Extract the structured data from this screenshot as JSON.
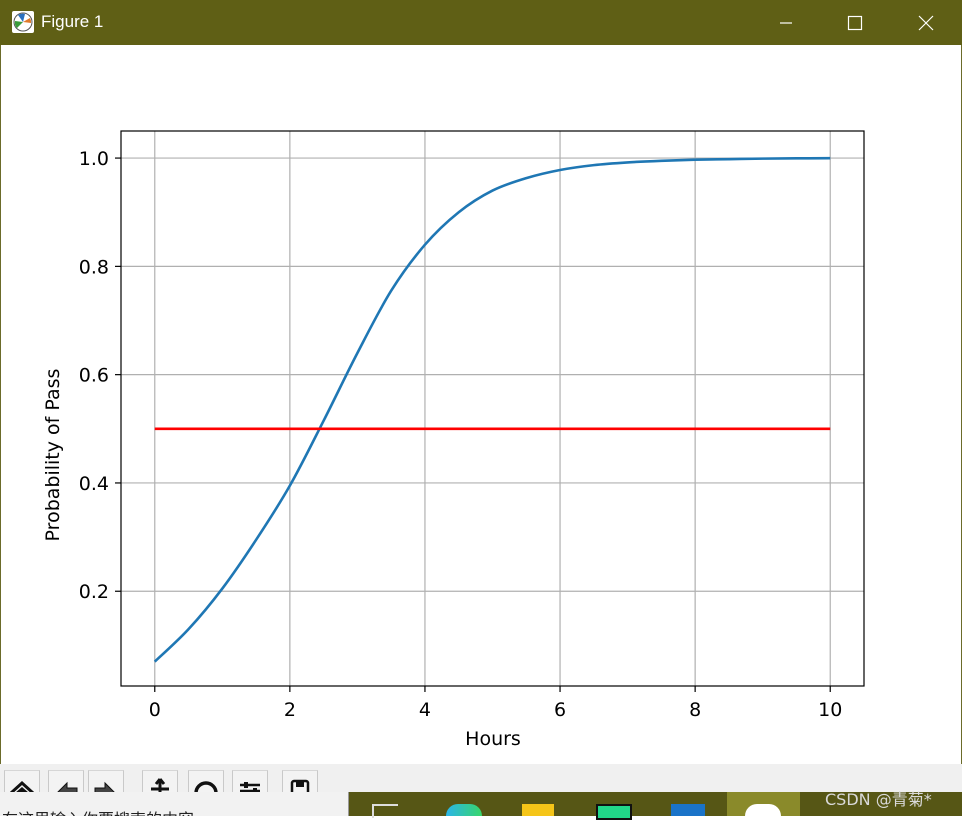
{
  "window": {
    "title": "Figure 1",
    "icon": "matplotlib-figure-icon",
    "controls": [
      "minimize-icon",
      "maximize-icon",
      "close-icon"
    ]
  },
  "chart_data": {
    "type": "line",
    "title": "",
    "xlabel": "Hours",
    "ylabel": "Probability of Pass",
    "xlim": [
      -0.5,
      10.5
    ],
    "ylim": [
      0.025,
      1.05
    ],
    "xticks": [
      0,
      2,
      4,
      6,
      8,
      10
    ],
    "xtick_labels": [
      "0",
      "2",
      "4",
      "6",
      "8",
      "10"
    ],
    "yticks": [
      0.2,
      0.4,
      0.6,
      0.8,
      1.0
    ],
    "ytick_labels": [
      "0.2",
      "0.4",
      "0.6",
      "0.8",
      "1.0"
    ],
    "grid": true,
    "series": [
      {
        "color": "#1f77b4",
        "x": [
          0,
          0.5,
          1,
          1.5,
          2,
          2.5,
          3,
          3.5,
          4,
          4.5,
          5,
          5.5,
          6,
          6.5,
          7,
          7.5,
          8,
          8.5,
          9,
          9.5,
          10
        ],
        "y": [
          0.07,
          0.13,
          0.205,
          0.295,
          0.395,
          0.515,
          0.64,
          0.755,
          0.84,
          0.9,
          0.94,
          0.963,
          0.978,
          0.987,
          0.992,
          0.995,
          0.997,
          0.998,
          0.999,
          0.9995,
          0.9997
        ]
      },
      {
        "color": "#ff0000",
        "x": [
          0,
          10
        ],
        "y": [
          0.5,
          0.5
        ]
      }
    ]
  },
  "toolbar": {
    "buttons": [
      "home-icon",
      "back-icon",
      "forward-icon",
      "pan-icon",
      "zoom-icon",
      "subplots-icon",
      "save-icon"
    ]
  },
  "taskbar": {
    "search_text": "在这里输入你要搜索的内容",
    "watermark": "CSDN @青菊*"
  }
}
